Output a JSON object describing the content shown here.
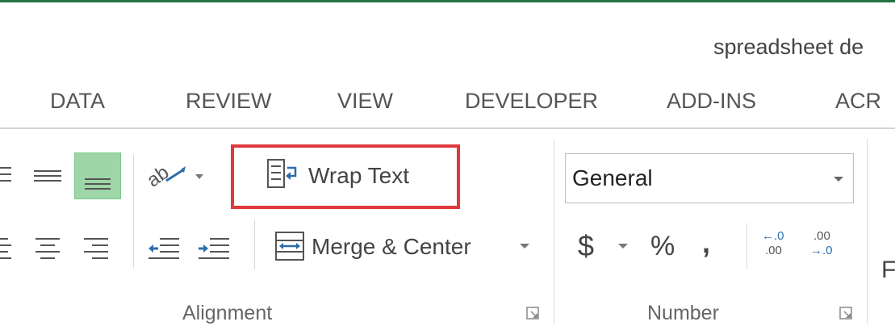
{
  "window": {
    "document_title": "spreadsheet de"
  },
  "tabs": [
    {
      "label": "DATA"
    },
    {
      "label": "REVIEW"
    },
    {
      "label": "VIEW"
    },
    {
      "label": "DEVELOPER"
    },
    {
      "label": "ADD-INS"
    },
    {
      "label": "ACR"
    }
  ],
  "alignment": {
    "wrap_text_label": "Wrap Text",
    "merge_center_label": "Merge & Center",
    "group_label": "Alignment",
    "bottom_align_active": true
  },
  "number": {
    "format_value": "General",
    "currency_symbol": "$",
    "percent_symbol": "%",
    "comma_symbol": ",",
    "increase_decimal_top": "←.0",
    "increase_decimal_bottom": ".00",
    "decrease_decimal_top": ".00",
    "decrease_decimal_bottom": "→.0",
    "group_label": "Number"
  },
  "partial_right": {
    "letter": "F"
  },
  "colors": {
    "accent_green": "#217346",
    "highlight_red": "#e0383b",
    "active_button": "#9fd6a8"
  }
}
